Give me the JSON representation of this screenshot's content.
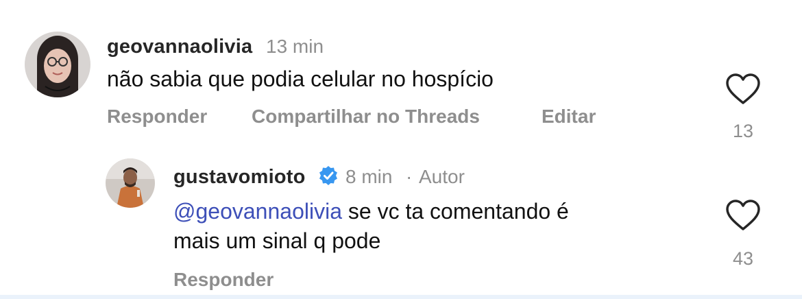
{
  "comments": [
    {
      "username": "geovannaolivia",
      "time": "13 min",
      "text": "não sabia que podia celular no hospício",
      "actions": {
        "reply": "Responder",
        "share": "Compartilhar no Threads",
        "edit": "Editar"
      },
      "likes": "13"
    },
    {
      "username": "gustavomioto",
      "verified": true,
      "time": "8 min",
      "separator": "·",
      "role": "Autor",
      "mention": "@geovannaolivia",
      "text_line1": " se vc ta comentando é",
      "text_line2": "mais um sinal q pode",
      "actions": {
        "reply": "Responder"
      },
      "likes": "43"
    }
  ],
  "icons": {
    "like": "heart-outline-icon",
    "verified": "verified-badge-icon"
  },
  "colors": {
    "mention": "#3d4fb8",
    "verified": "#3897f0",
    "muted": "#8e8e8e"
  }
}
